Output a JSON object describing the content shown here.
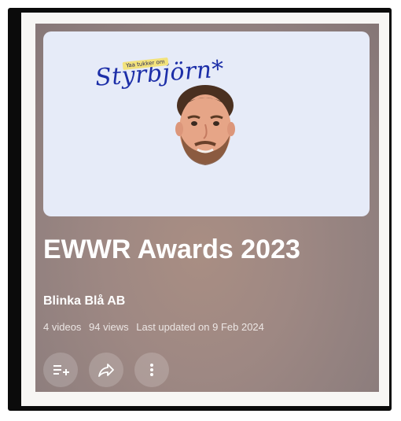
{
  "thumbnail": {
    "badge": "Yaa tukker om",
    "brand": "Styrbjörn*"
  },
  "playlist": {
    "title": "EWWR Awards 2023",
    "channel": "Blinka Blå AB",
    "video_count": "4 videos",
    "views": "94 views",
    "last_updated": "Last updated on 9 Feb 2024"
  },
  "actions": {
    "icons": [
      "playlist-add-icon",
      "share-icon",
      "more-vert-icon"
    ]
  },
  "colors": {
    "card_bg": "#9a8583",
    "thumbnail_bg": "#e6ebf8",
    "brand_text": "#1c2ea8",
    "text_primary": "#ffffff"
  }
}
